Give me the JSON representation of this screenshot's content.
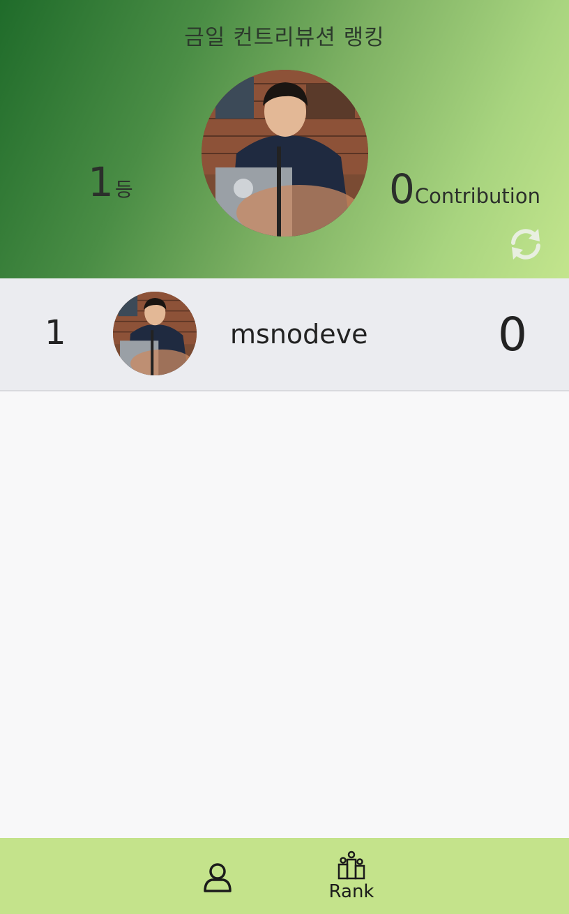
{
  "header": {
    "title": "금일 컨트리뷰션 랭킹",
    "rank_value": "1",
    "rank_unit": "등",
    "contribution_value": "0",
    "contribution_unit": "Contribution"
  },
  "ranking": [
    {
      "rank": "1",
      "username": "msnodeve",
      "score": "0"
    }
  ],
  "nav": {
    "profile_label": "",
    "rank_label": "Rank"
  },
  "colors": {
    "header_gradient_start": "#1f6b2a",
    "header_gradient_end": "#c3e58d",
    "row_background": "#ebecf0",
    "nav_background": "#c4e38b"
  },
  "icons": {
    "refresh": "refresh-icon",
    "profile": "user-icon",
    "rank": "podium-icon"
  }
}
